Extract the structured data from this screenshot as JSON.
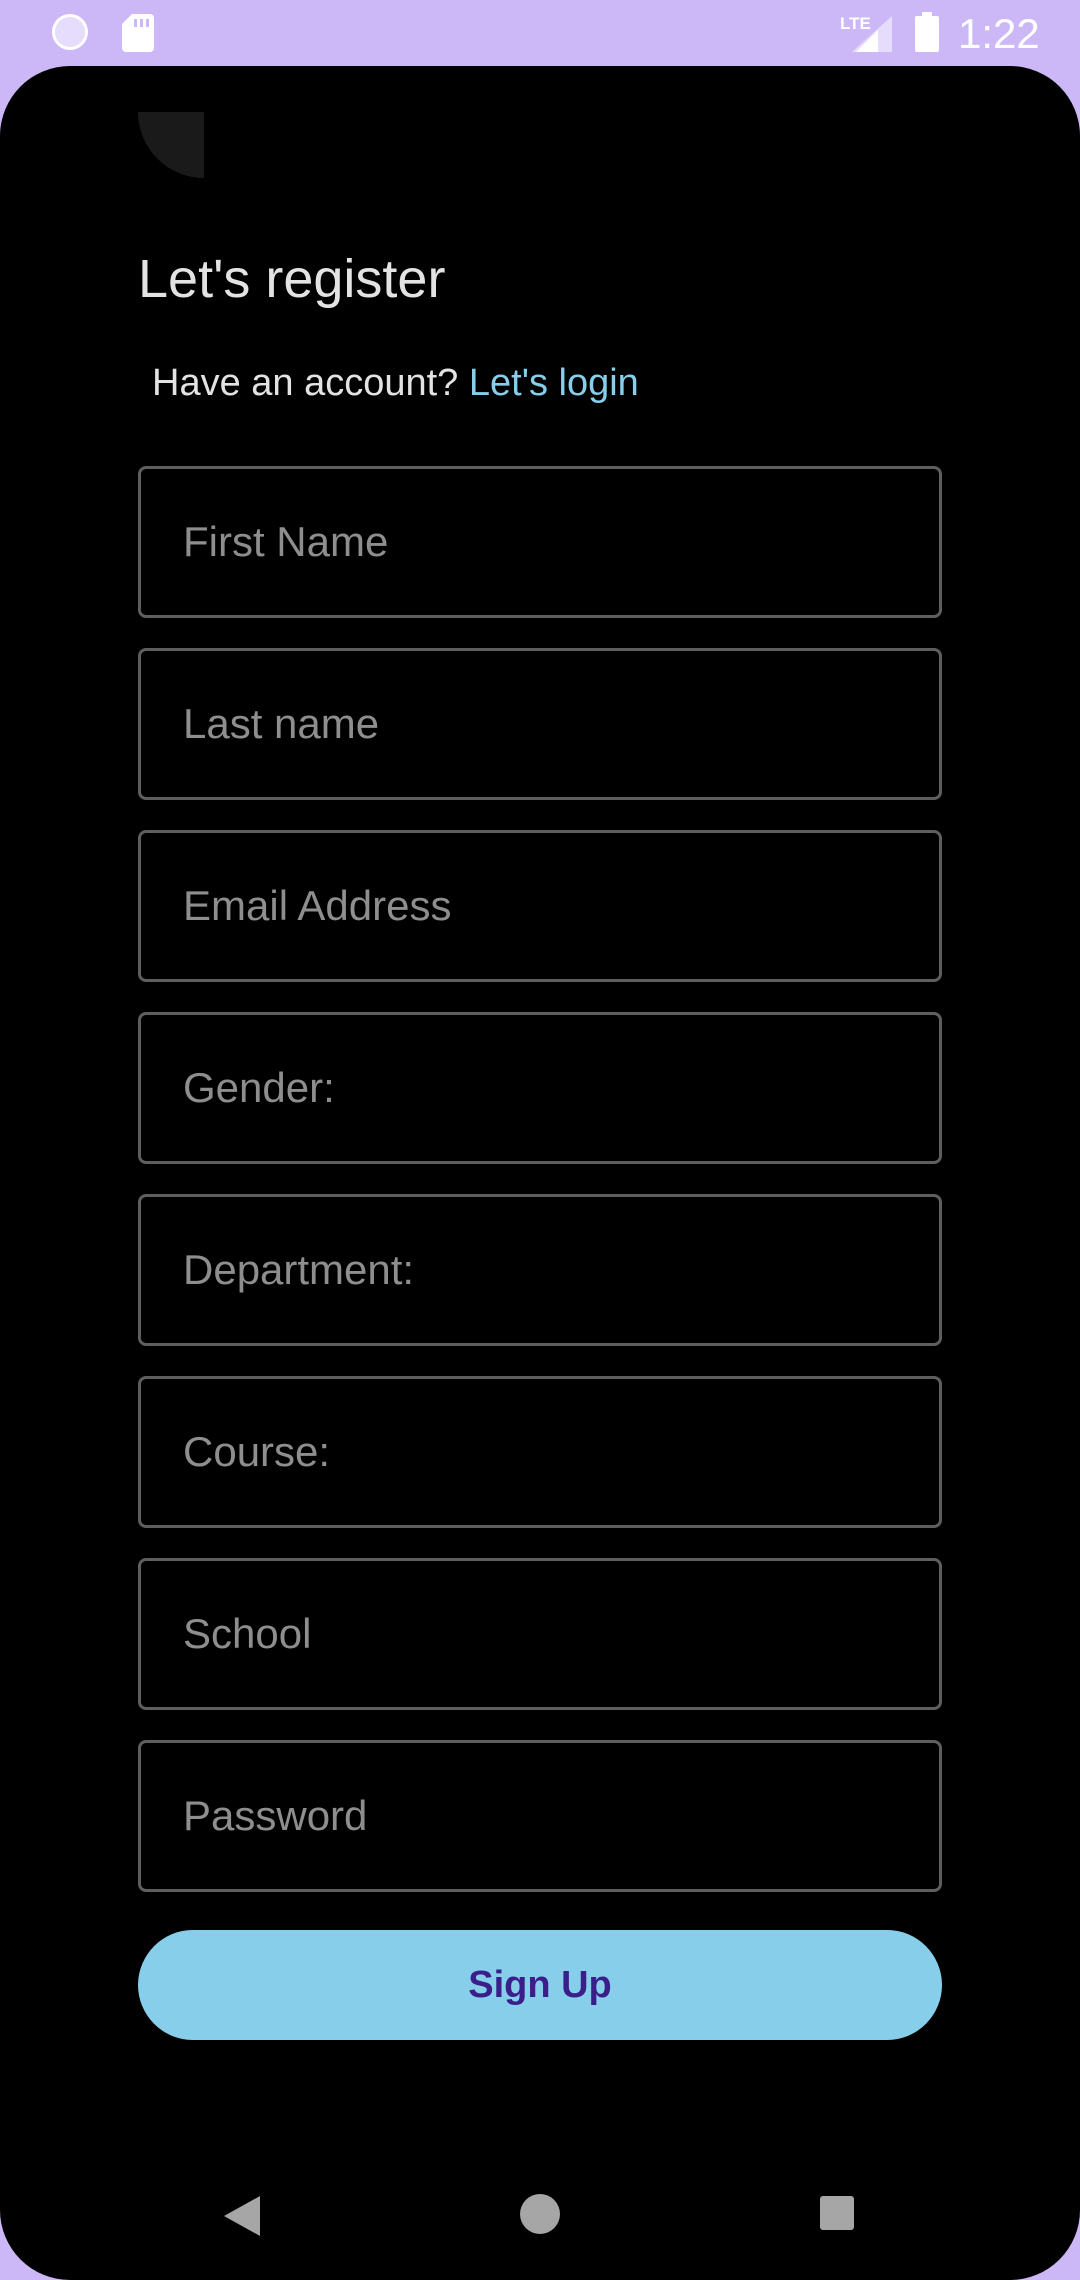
{
  "status_bar": {
    "network": "LTE",
    "time": "1:22",
    "icons": [
      "loading-circle-icon",
      "sd-card-icon",
      "signal-icon",
      "battery-icon"
    ]
  },
  "header": {
    "title": "Let's register",
    "have_account_text": "Have an account? ",
    "login_link": "Let's login"
  },
  "form": {
    "fields": [
      {
        "name": "first-name",
        "placeholder": "First Name",
        "value": ""
      },
      {
        "name": "last-name",
        "placeholder": "Last name",
        "value": ""
      },
      {
        "name": "email-address",
        "placeholder": "Email Address",
        "value": ""
      },
      {
        "name": "gender",
        "placeholder": "Gender:",
        "value": ""
      },
      {
        "name": "department",
        "placeholder": "Department:",
        "value": ""
      },
      {
        "name": "course",
        "placeholder": "Course:",
        "value": ""
      },
      {
        "name": "school",
        "placeholder": "School",
        "value": ""
      },
      {
        "name": "password",
        "placeholder": "Password",
        "value": ""
      }
    ],
    "submit_label": "Sign Up"
  },
  "nav_bar": {
    "icons": [
      "back-icon",
      "home-icon",
      "recents-icon"
    ]
  },
  "colors": {
    "status_bar_bg": "#cdb8f7",
    "app_bg": "#000000",
    "accent": "#87ceeb",
    "button_text": "#3a1f8a",
    "field_border": "#5e5e5e",
    "placeholder": "#8e8e8e"
  }
}
